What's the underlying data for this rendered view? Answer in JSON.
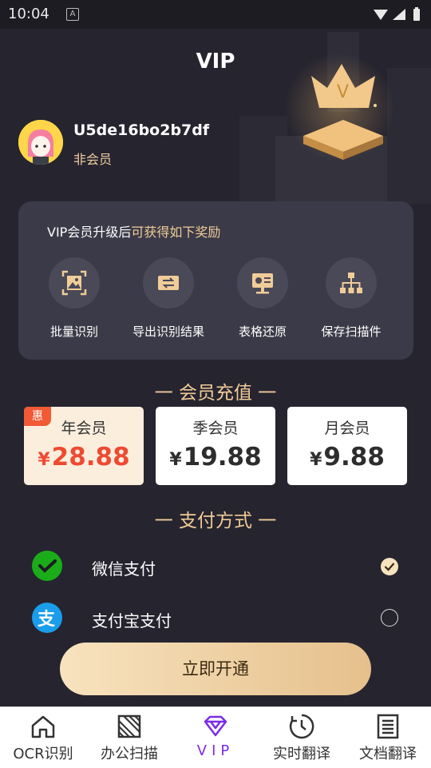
{
  "status_bar": {
    "time": "10:04",
    "notif": "A"
  },
  "header": {
    "title": "VIP"
  },
  "user": {
    "name": "U5de16bo2b7df",
    "status": "非会员"
  },
  "benefits": {
    "title_plain": "VIP会员升级后",
    "title_highlight": "可获得如下奖励",
    "items": [
      {
        "label": "批量识别",
        "icon": "image-scan-icon"
      },
      {
        "label": "导出识别结果",
        "icon": "export-icon"
      },
      {
        "label": "表格还原",
        "icon": "table-restore-icon"
      },
      {
        "label": "保存扫描件",
        "icon": "save-scan-icon"
      }
    ]
  },
  "membership": {
    "title": "一 会员充值 一",
    "plans": [
      {
        "name": "年会员",
        "currency": "¥",
        "price": "28.88",
        "tag": "惠",
        "selected": true
      },
      {
        "name": "季会员",
        "currency": "¥",
        "price": "19.88",
        "selected": false
      },
      {
        "name": "月会员",
        "currency": "¥",
        "price": "9.88",
        "selected": false
      }
    ]
  },
  "payment": {
    "title": "一 支付方式 一",
    "methods": [
      {
        "label": "微信支付",
        "icon": "wechat-pay-icon",
        "color": "#1aad19",
        "checked": true
      },
      {
        "label": "支付宝支付",
        "icon": "alipay-icon",
        "color": "#1a9dea",
        "checked": false
      }
    ]
  },
  "cta": {
    "label": "立即开通"
  },
  "tabs": [
    {
      "label": "OCR识别",
      "icon": "home-icon",
      "active": false
    },
    {
      "label": "办公扫描",
      "icon": "scan-icon",
      "active": false
    },
    {
      "label": "VIP",
      "icon": "diamond-icon",
      "active": true
    },
    {
      "label": "实时翻译",
      "icon": "clock-icon",
      "active": false
    },
    {
      "label": "文档翻译",
      "icon": "document-icon",
      "active": false
    }
  ],
  "colors": {
    "accent_gold": "#f0cc98",
    "price_red": "#ee4a32",
    "tab_active": "#7a2ce6",
    "background": "#26242f"
  }
}
